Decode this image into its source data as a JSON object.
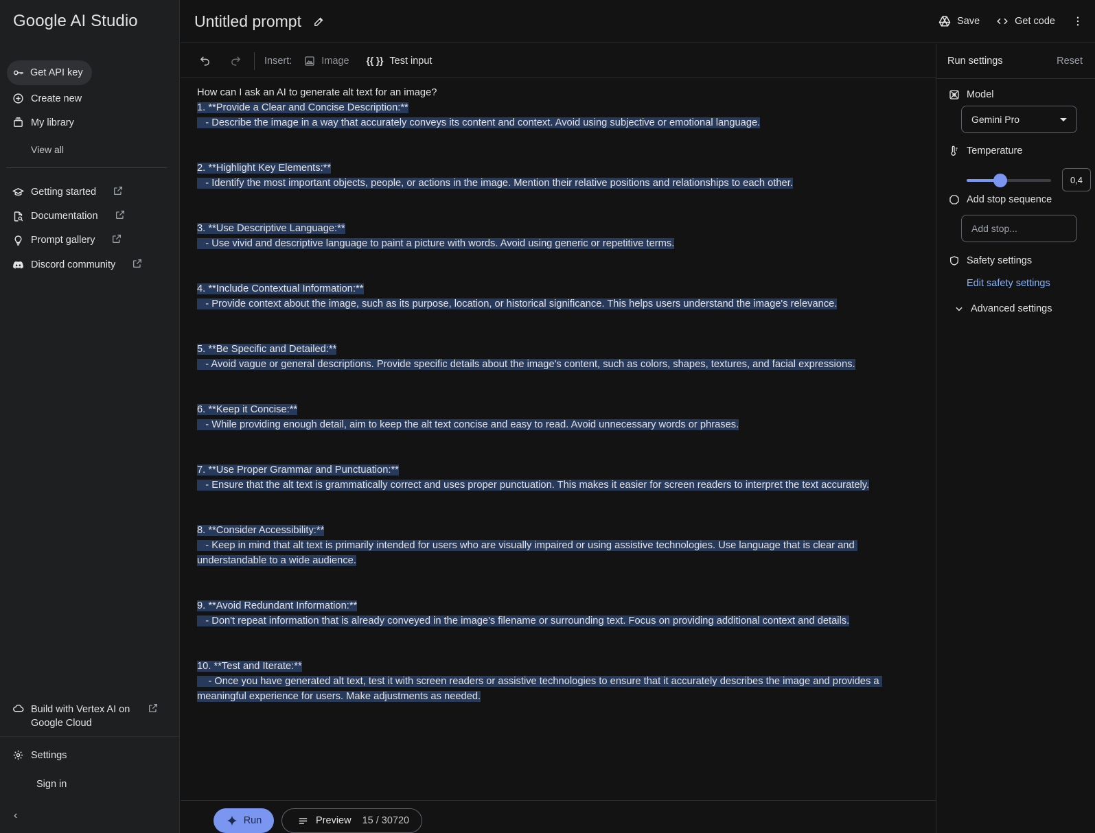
{
  "sidebar": {
    "logo": "Google AI Studio",
    "api_key": "Get API key",
    "create_new": "Create new",
    "my_library": "My library",
    "view_all": "View all",
    "links": [
      {
        "label": "Getting started"
      },
      {
        "label": "Documentation"
      },
      {
        "label": "Prompt gallery"
      },
      {
        "label": "Discord community"
      }
    ],
    "vertex": "Build with Vertex AI on Google Cloud",
    "settings": "Settings",
    "sign_in": "Sign in"
  },
  "header": {
    "title": "Untitled prompt",
    "save": "Save",
    "get_code": "Get code"
  },
  "toolbar": {
    "insert": "Insert:",
    "image": "Image",
    "test_input_glyph": "{{ }}",
    "test_input": "Test input"
  },
  "editor": {
    "question": "How can I ask an AI to generate alt text for an image?",
    "items": [
      {
        "heading": "1. **Provide a Clear and Concise Description:**",
        "body": "   - Describe the image in a way that accurately conveys its content and context. Avoid using subjective or emotional language."
      },
      {
        "heading": "2. **Highlight Key Elements:**",
        "body": "   - Identify the most important objects, people, or actions in the image. Mention their relative positions and relationships to each other."
      },
      {
        "heading": "3. **Use Descriptive Language:**",
        "body": "   - Use vivid and descriptive language to paint a picture with words. Avoid using generic or repetitive terms."
      },
      {
        "heading": "4. **Include Contextual Information:**",
        "body": "   - Provide context about the image, such as its purpose, location, or historical significance. This helps users understand the image's relevance."
      },
      {
        "heading": "5. **Be Specific and Detailed:**",
        "body": "   - Avoid vague or general descriptions. Provide specific details about the image's content, such as colors, shapes, textures, and facial expressions."
      },
      {
        "heading": "6. **Keep it Concise:**",
        "body": "   - While providing enough detail, aim to keep the alt text concise and easy to read. Avoid unnecessary words or phrases."
      },
      {
        "heading": "7. **Use Proper Grammar and Punctuation:**",
        "body": "   - Ensure that the alt text is grammatically correct and uses proper punctuation. This makes it easier for screen readers to interpret the text accurately."
      },
      {
        "heading": "8. **Consider Accessibility:**",
        "body": "   - Keep in mind that alt text is primarily intended for users who are visually impaired or using assistive technologies. Use language that is clear and understandable to a wide audience."
      },
      {
        "heading": "9. **Avoid Redundant Information:**",
        "body": "   - Don't repeat information that is already conveyed in the image's filename or surrounding text. Focus on providing additional context and details."
      },
      {
        "heading": "10. **Test and Iterate:**",
        "body": "    - Once you have generated alt text, test it with screen readers or assistive technologies to ensure that it accurately describes the image and provides a meaningful experience for users. Make adjustments as needed."
      }
    ]
  },
  "bottom": {
    "run": "Run",
    "preview": "Preview",
    "token_count": "15 / 30720"
  },
  "run_settings": {
    "title": "Run settings",
    "reset": "Reset",
    "model_label": "Model",
    "model_value": "Gemini Pro",
    "temperature_label": "Temperature",
    "temperature_value": "0,4",
    "temperature_fraction": 0.4,
    "stop_label": "Add stop sequence",
    "stop_placeholder": "Add stop...",
    "safety_label": "Safety settings",
    "edit_safety": "Edit safety settings",
    "advanced": "Advanced settings"
  },
  "colors": {
    "accent": "#7b96f0",
    "link": "#8ab4f8",
    "selection": "#283a5c"
  }
}
